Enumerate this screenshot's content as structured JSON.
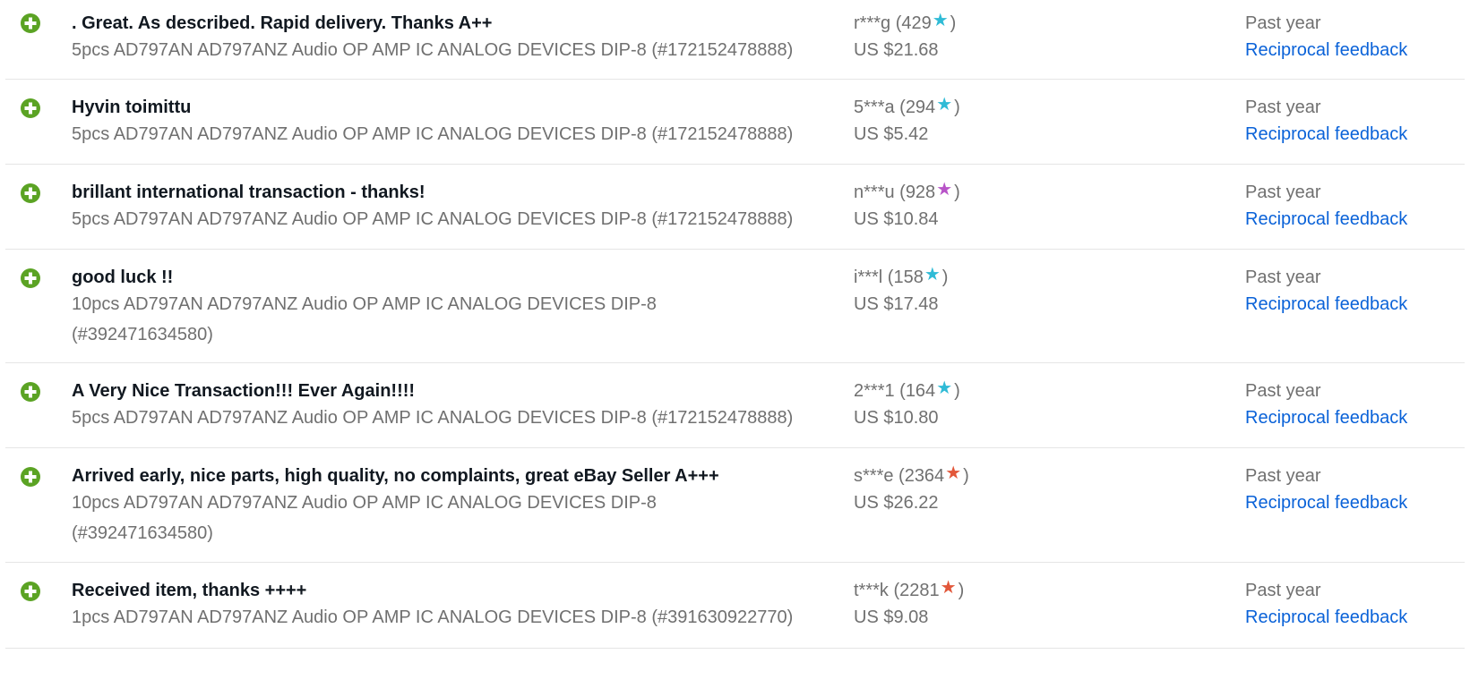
{
  "feedback": [
    {
      "rating": "positive",
      "comment": ". Great. As described. Rapid delivery. Thanks A++",
      "item": "5pcs AD797AN AD797ANZ Audio OP AMP IC ANALOG DEVICES DIP-8 (#172152478888)",
      "buyer": "r***g (429",
      "buyer_close": ")",
      "star_color": "#2fbbd6",
      "price": "US $21.68",
      "when": "Past year",
      "reciprocal": "Reciprocal feedback"
    },
    {
      "rating": "positive",
      "comment": "Hyvin toimittu",
      "item": "5pcs AD797AN AD797ANZ Audio OP AMP IC ANALOG DEVICES DIP-8 (#172152478888)",
      "buyer": "5***a (294",
      "buyer_close": ")",
      "star_color": "#2fbbd6",
      "price": "US $5.42",
      "when": "Past year",
      "reciprocal": "Reciprocal feedback"
    },
    {
      "rating": "positive",
      "comment": "brillant international transaction - thanks!",
      "item": "5pcs AD797AN AD797ANZ Audio OP AMP IC ANALOG DEVICES DIP-8 (#172152478888)",
      "buyer": "n***u (928",
      "buyer_close": ")",
      "star_color": "#b854c8",
      "price": "US $10.84",
      "when": "Past year",
      "reciprocal": "Reciprocal feedback"
    },
    {
      "rating": "positive",
      "comment": "good luck !!",
      "item": "10pcs AD797AN AD797ANZ Audio OP AMP IC ANALOG DEVICES DIP-8 (#392471634580)",
      "buyer": "i***l (158",
      "buyer_close": ")",
      "star_color": "#2fbbd6",
      "price": "US $17.48",
      "when": "Past year",
      "reciprocal": "Reciprocal feedback"
    },
    {
      "rating": "positive",
      "comment": "A Very Nice Transaction!!! Ever Again!!!!",
      "item": "5pcs AD797AN AD797ANZ Audio OP AMP IC ANALOG DEVICES DIP-8 (#172152478888)",
      "buyer": "2***1 (164",
      "buyer_close": ")",
      "star_color": "#2fbbd6",
      "price": "US $10.80",
      "when": "Past year",
      "reciprocal": "Reciprocal feedback"
    },
    {
      "rating": "positive",
      "comment": "Arrived early, nice parts, high quality, no complaints, great eBay Seller A+++",
      "item": "10pcs AD797AN AD797ANZ Audio OP AMP IC ANALOG DEVICES DIP-8 (#392471634580)",
      "buyer": "s***e (2364",
      "buyer_close": ")",
      "star_color": "#e2573a",
      "price": "US $26.22",
      "when": "Past year",
      "reciprocal": "Reciprocal feedback"
    },
    {
      "rating": "positive",
      "comment": "Received item, thanks ++++",
      "item": "1pcs AD797AN AD797ANZ Audio OP AMP IC ANALOG DEVICES DIP-8 (#391630922770)",
      "buyer": "t***k (2281",
      "buyer_close": ")",
      "star_color": "#e2573a",
      "price": "US $9.08",
      "when": "Past year",
      "reciprocal": "Reciprocal feedback"
    }
  ],
  "colors": {
    "positive_icon": "#5ba324",
    "link": "#0a62d8"
  }
}
